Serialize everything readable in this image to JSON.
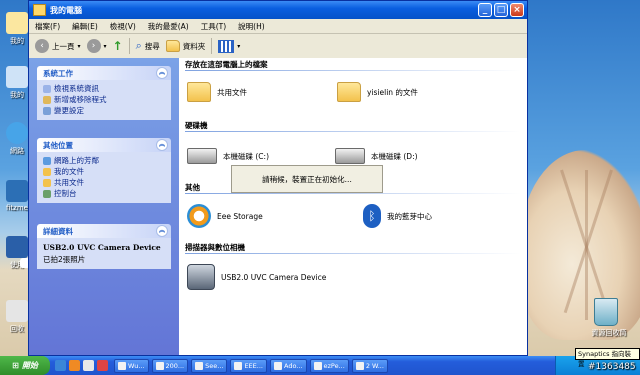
{
  "desktop": {
    "icons": [
      "我的",
      "我的",
      "網路",
      "fitzme",
      "使用",
      "",
      "回收"
    ],
    "recycle_label": "資源回收筒"
  },
  "window": {
    "title": "我的電腦",
    "menu": [
      "檔案(F)",
      "編輯(E)",
      "檢視(V)",
      "我的最愛(A)",
      "工具(T)",
      "說明(H)"
    ],
    "toolbar": {
      "back": "上一頁",
      "search": "搜尋",
      "folders": "資料夾"
    }
  },
  "left": {
    "system_tasks": {
      "title": "系統工作",
      "items": [
        "檢視系統資訊",
        "新增或移除程式",
        "變更設定"
      ]
    },
    "other_places": {
      "title": "其他位置",
      "items": [
        "網路上的芳鄰",
        "我的文件",
        "共用文件",
        "控制台"
      ]
    },
    "details": {
      "title": "詳細資料",
      "name": "USB2.0 UVC Camera Device",
      "desc": "已拍2張照片"
    }
  },
  "main": {
    "groups": {
      "files": "存放在這部電腦上的檔案",
      "drives": "硬碟機",
      "other": "其他",
      "scanners": "掃描器與數位相機"
    },
    "items": {
      "shared_docs": "共用文件",
      "user_docs": "yisielin 的文件",
      "drive_c": "本機磁碟 (C:)",
      "drive_d": "本機磁碟 (D:)",
      "eee": "Eee Storage",
      "bluetooth": "我的藍芽中心",
      "camera": "USB2.0 UVC Camera Device"
    },
    "popup": "請稍候，裝置正在初始化..."
  },
  "taskbar": {
    "start": "開始",
    "tasks": [
      "Wu...",
      "200...",
      "See...",
      "EEE...",
      "Ado...",
      "ezPe...",
      "2 W..."
    ],
    "tooltip": "Synaptics 指向裝置",
    "watermark": "#1363485"
  }
}
